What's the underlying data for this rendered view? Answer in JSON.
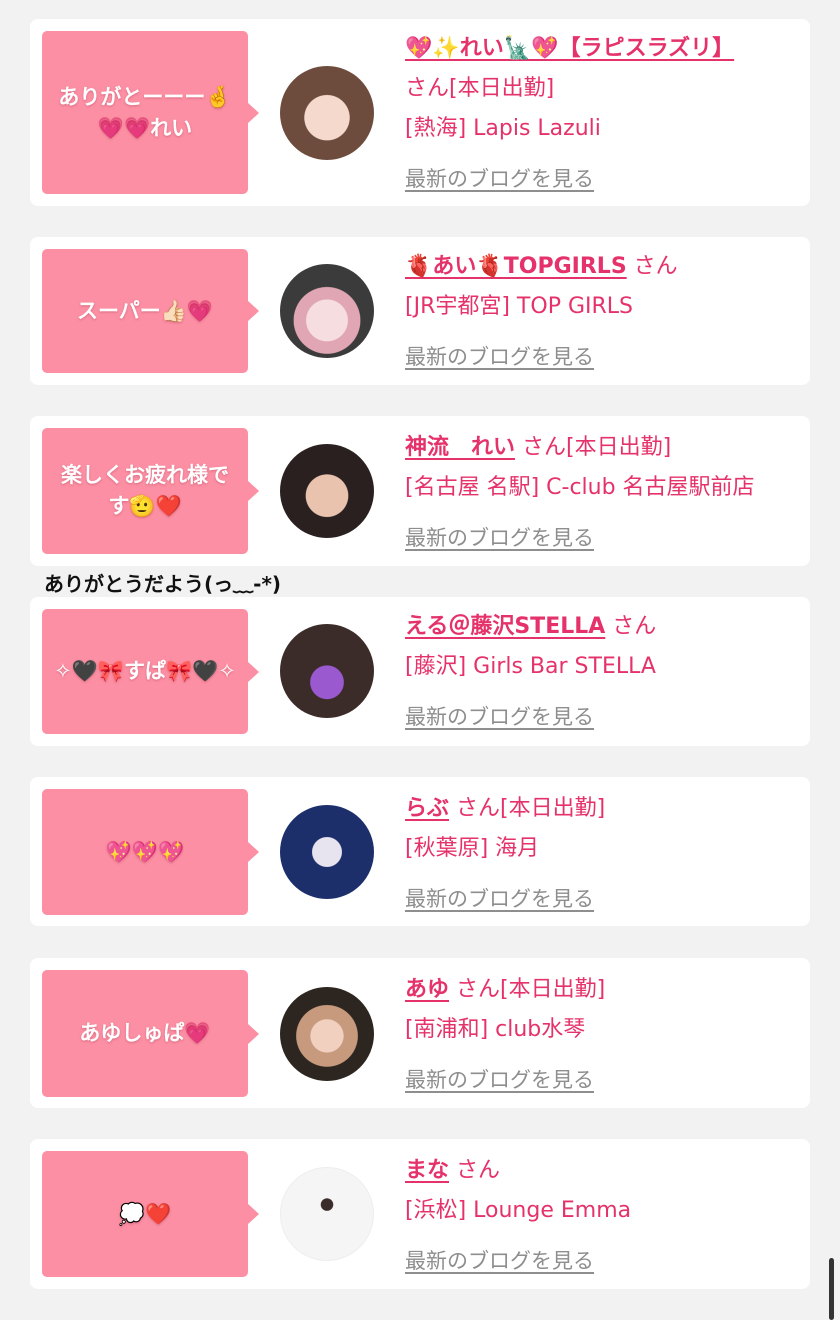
{
  "colors": {
    "accent": "#e5326a",
    "bubble": "#fc8fa3",
    "muted": "#8e8e8e",
    "background": "#f2f2f2"
  },
  "floating_note": "ありがとうだよう(っ﹏-*)",
  "cards": [
    {
      "message": "ありがとーーー🤞💗💗れい",
      "name": "💖✨れい🗽💖【ラピスラズリ】",
      "san": "さん",
      "status": "[本日出勤]",
      "shop": "[熱海] Lapis Lazuli",
      "blog": "最新のブログを見る"
    },
    {
      "message": "スーパー👍🏻💗",
      "name": "🫀あい🫀TOPGIRLS",
      "san": "さん",
      "status": "",
      "shop": "[JR宇都宮] TOP GIRLS",
      "blog": "最新のブログを見る"
    },
    {
      "message": "楽しくお疲れ様です🫡❤️",
      "name": "神流　れい",
      "san": "さん",
      "status": "[本日出勤]",
      "shop": "[名古屋 名駅] C-club 名古屋駅前店",
      "blog": "最新のブログを見る"
    },
    {
      "message": "✧🖤🎀すぱ🎀🖤✧",
      "name": "える＠藤沢STELLA",
      "san": "さん",
      "status": "",
      "shop": "[藤沢] Girls Bar STELLA",
      "blog": "最新のブログを見る"
    },
    {
      "message": "💖💖💖",
      "name": "らぶ",
      "san": "さん",
      "status": "[本日出勤]",
      "shop": "[秋葉原] 海月",
      "blog": "最新のブログを見る"
    },
    {
      "message": "あゆしゅぱ💗",
      "name": "あゆ",
      "san": "さん",
      "status": "[本日出勤]",
      "shop": "[南浦和] club水琴",
      "blog": "最新のブログを見る"
    },
    {
      "message": "💭❤️",
      "name": "まな",
      "san": "さん",
      "status": "",
      "shop": "[浜松] Lounge Emma",
      "blog": "最新のブログを見る"
    }
  ]
}
